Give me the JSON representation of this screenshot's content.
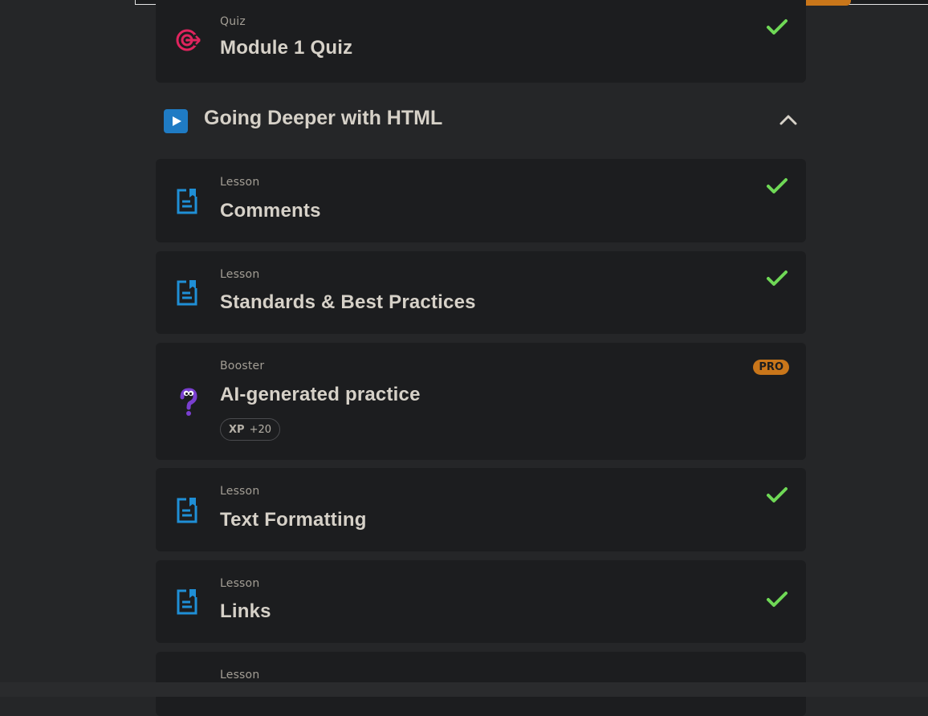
{
  "colors": {
    "background": "#252628",
    "card": "#1c1d1f",
    "accent_orange": "#c9761a",
    "lesson_icon_blue": "#1f8fd6",
    "check_green": "#6fd856",
    "quiz_red": "#e0245e",
    "booster_purple": "#7a3fd0"
  },
  "quiz_item": {
    "type": "Quiz",
    "title": "Module 1 Quiz",
    "icon": "target-icon",
    "completed": true
  },
  "section": {
    "title": "Going Deeper with HTML",
    "icon": "play-icon",
    "expanded": true
  },
  "items": [
    {
      "type": "Lesson",
      "title": "Comments",
      "icon": "lesson-doc-icon",
      "completed": true
    },
    {
      "type": "Lesson",
      "title": "Standards & Best Practices",
      "icon": "lesson-doc-icon",
      "completed": true
    },
    {
      "type": "Booster",
      "title": "AI-generated practice",
      "icon": "question-mascot-icon",
      "badge": "PRO",
      "xp_label": "XP",
      "xp_value": "+20"
    },
    {
      "type": "Lesson",
      "title": "Text Formatting",
      "icon": "lesson-doc-icon",
      "completed": true
    },
    {
      "type": "Lesson",
      "title": "Links",
      "icon": "lesson-doc-icon",
      "completed": true
    },
    {
      "type": "Lesson",
      "title": "",
      "icon": "lesson-doc-icon"
    }
  ]
}
